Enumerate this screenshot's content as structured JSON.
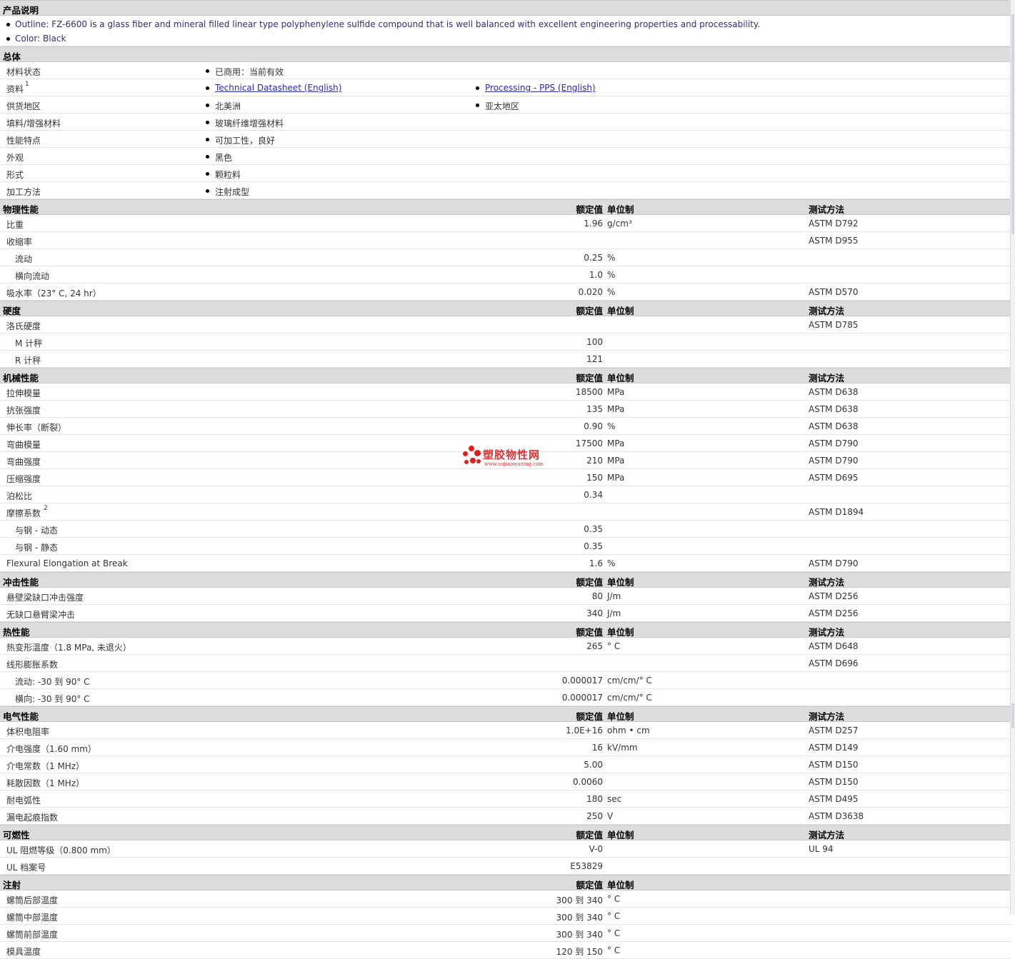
{
  "description": {
    "title": "产品说明",
    "items": [
      "Outline: FZ-6600 is a glass fiber and mineral filled linear type polyphenylene sulfide compound that is well balanced with excellent engineering properties and processability.",
      "Color: Black"
    ]
  },
  "general": {
    "title": "总体",
    "rows": [
      {
        "label": "材料状态",
        "items": [
          "已商用：当前有效"
        ]
      },
      {
        "label": "资料",
        "sup": "1",
        "items": [
          "Technical Datasheet (English)",
          "Processing - PPS (English)"
        ],
        "links": true
      },
      {
        "label": "供货地区",
        "items": [
          "北美洲",
          "亚太地区"
        ]
      },
      {
        "label": "填料/增强材料",
        "items": [
          "玻璃纤维增强材料"
        ]
      },
      {
        "label": "性能特点",
        "items": [
          "可加工性，良好"
        ]
      },
      {
        "label": "外观",
        "items": [
          "黑色"
        ]
      },
      {
        "label": "形式",
        "items": [
          "颗粒料"
        ]
      },
      {
        "label": "加工方法",
        "items": [
          "注射成型"
        ]
      }
    ]
  },
  "column_headers": {
    "value": "额定值",
    "unit": "单位制",
    "test": "测试方法"
  },
  "sections": [
    {
      "title": "物理性能",
      "show_test": true,
      "rows": [
        {
          "label": "比重",
          "value": "1.96",
          "unit": "g/cm³",
          "test": "ASTM D792"
        },
        {
          "label": "收缩率",
          "value": "",
          "unit": "",
          "test": "ASTM D955"
        },
        {
          "label": "流动",
          "sub": true,
          "value": "0.25",
          "unit": "%",
          "test": ""
        },
        {
          "label": "横向流动",
          "sub": true,
          "value": "1.0",
          "unit": "%",
          "test": ""
        },
        {
          "label": "吸水率（23°  C, 24 hr）",
          "value": "0.020",
          "unit": "%",
          "test": "ASTM D570"
        }
      ]
    },
    {
      "title": "硬度",
      "show_test": true,
      "rows": [
        {
          "label": "洛氏硬度",
          "value": "",
          "unit": "",
          "test": "ASTM D785"
        },
        {
          "label": "M 计秤",
          "sub": true,
          "value": "100",
          "unit": "",
          "test": ""
        },
        {
          "label": "R 计秤",
          "sub": true,
          "value": "121",
          "unit": "",
          "test": ""
        }
      ]
    },
    {
      "title": "机械性能",
      "show_test": true,
      "rows": [
        {
          "label": "拉伸模量",
          "value": "18500",
          "unit": "MPa",
          "test": "ASTM D638"
        },
        {
          "label": "抗张强度",
          "value": "135",
          "unit": "MPa",
          "test": "ASTM D638"
        },
        {
          "label": "伸长率（断裂）",
          "value": "0.90",
          "unit": "%",
          "test": "ASTM D638"
        },
        {
          "label": "弯曲模量",
          "value": "17500",
          "unit": "MPa",
          "test": "ASTM D790"
        },
        {
          "label": "弯曲强度",
          "value": "210",
          "unit": "MPa",
          "test": "ASTM D790"
        },
        {
          "label": "压缩强度",
          "value": "150",
          "unit": "MPa",
          "test": "ASTM D695"
        },
        {
          "label": "泊松比",
          "value": "0.34",
          "unit": "",
          "test": ""
        },
        {
          "label": "摩擦系数",
          "sup": "2",
          "value": "",
          "unit": "",
          "test": "ASTM D1894"
        },
        {
          "label": "与钢  - 动态",
          "sub": true,
          "value": "0.35",
          "unit": "",
          "test": ""
        },
        {
          "label": "与钢  - 静态",
          "sub": true,
          "value": "0.35",
          "unit": "",
          "test": ""
        },
        {
          "label": "Flexural Elongation at Break",
          "value": "1.6",
          "unit": "%",
          "test": "ASTM D790"
        }
      ]
    },
    {
      "title": "冲击性能",
      "show_test": true,
      "rows": [
        {
          "label": "悬壁梁缺口冲击强度",
          "value": "80",
          "unit": "J/m",
          "test": "ASTM D256"
        },
        {
          "label": "无缺口悬臂梁冲击",
          "value": "340",
          "unit": "J/m",
          "test": "ASTM D256"
        }
      ]
    },
    {
      "title": "热性能",
      "show_test": true,
      "rows": [
        {
          "label": "热变形温度（1.8 MPa, 未退火）",
          "value": "265",
          "unit": "°  C",
          "test": "ASTM D648"
        },
        {
          "label": "线形膨胀系数",
          "value": "",
          "unit": "",
          "test": "ASTM D696"
        },
        {
          "label": "流动: -30 到  90°  C",
          "sub": true,
          "value": "0.000017",
          "unit": "cm/cm/°  C",
          "test": ""
        },
        {
          "label": "横向: -30 到  90°  C",
          "sub": true,
          "value": "0.000017",
          "unit": "cm/cm/°  C",
          "test": ""
        }
      ]
    },
    {
      "title": "电气性能",
      "show_test": true,
      "rows": [
        {
          "label": "体积电阻率",
          "value": "1.0E+16",
          "unit": "ohm • cm",
          "test": "ASTM D257"
        },
        {
          "label": "介电强度（1.60 mm）",
          "value": "16",
          "unit": "kV/mm",
          "test": "ASTM D149"
        },
        {
          "label": "介电常数（1 MHz）",
          "value": "5.00",
          "unit": "",
          "test": "ASTM D150"
        },
        {
          "label": "耗散因数（1 MHz）",
          "value": "0.0060",
          "unit": "",
          "test": "ASTM D150"
        },
        {
          "label": "耐电弧性",
          "value": "180",
          "unit": "sec",
          "test": "ASTM D495"
        },
        {
          "label": "漏电起痕指数",
          "value": "250",
          "unit": "V",
          "test": "ASTM D3638"
        }
      ]
    },
    {
      "title": "可燃性",
      "show_test": true,
      "rows": [
        {
          "label": "UL 阻燃等级（0.800 mm）",
          "value": "V-0",
          "unit": "",
          "test": "UL 94"
        },
        {
          "label": "UL 档案号",
          "value": "E53829",
          "unit": "",
          "test": ""
        }
      ]
    },
    {
      "title": "注射",
      "show_test": false,
      "rows": [
        {
          "label": "螺筒后部温度",
          "value": "300 到  340",
          "unit": "°  C",
          "test": ""
        },
        {
          "label": "螺筒中部温度",
          "value": "300 到  340",
          "unit": "°  C",
          "test": ""
        },
        {
          "label": "螺筒前部温度",
          "value": "300 到  340",
          "unit": "°  C",
          "test": ""
        },
        {
          "label": "模具温度",
          "value": "120 到  150",
          "unit": "°  C",
          "test": ""
        }
      ]
    }
  ],
  "watermark": {
    "title": "塑胶物性网",
    "url": "www.sujiaowuxing.com",
    "color": "#e02020"
  }
}
